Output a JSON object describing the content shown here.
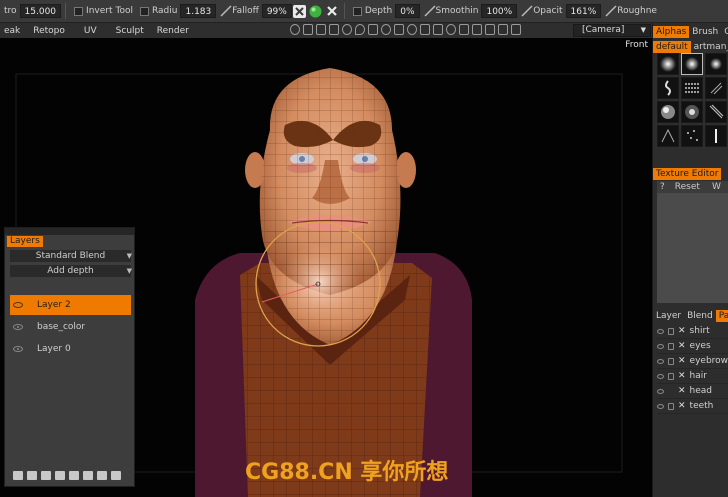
{
  "toolbar": {
    "stroke_label": "tro",
    "stroke_value": "15.000",
    "invert_label": "Invert",
    "tool_label": "Tool",
    "radius_label": "Radiu",
    "radius_value": "1.183",
    "falloff_label": "Falloff",
    "falloff_value": "99%",
    "depth_label": "Depth",
    "depth_value": "0%",
    "smoothing_label": "Smoothin",
    "smoothing_value": "100%",
    "opacity_label": "Opacit",
    "opacity_value": "161%",
    "roughness_label": "Roughne"
  },
  "menu": {
    "items": [
      "eak",
      "Retopo",
      "UV",
      "Sculpt",
      "Render"
    ],
    "camera": "[Camera]"
  },
  "viewport": {
    "view_label": "Front"
  },
  "layers_panel": {
    "tab": "Layers",
    "blend_mode": "Standard Blend",
    "add_mode": "Add depth",
    "layers": [
      {
        "name": "Layer 2",
        "active": true
      },
      {
        "name": "base_color",
        "active": false
      },
      {
        "name": "Layer 0",
        "active": false
      }
    ]
  },
  "right_panel": {
    "top_tabs": [
      "Alphas",
      "Brush",
      "C"
    ],
    "alpha_sets": [
      "default",
      "artman_"
    ],
    "texture_tabs": [
      "Texture Editor"
    ],
    "texture_tools": [
      "?",
      "Reset",
      "W"
    ],
    "object_tabs": [
      "Layer",
      "Blend",
      "Pain"
    ],
    "objects": [
      "shirt",
      "eyes",
      "eyebrow",
      "hair",
      "head",
      "teeth"
    ]
  },
  "watermark": "CG88.CN 享你所想",
  "colors": {
    "accent": "#ef7a06",
    "watermark": "#f0a21e"
  }
}
